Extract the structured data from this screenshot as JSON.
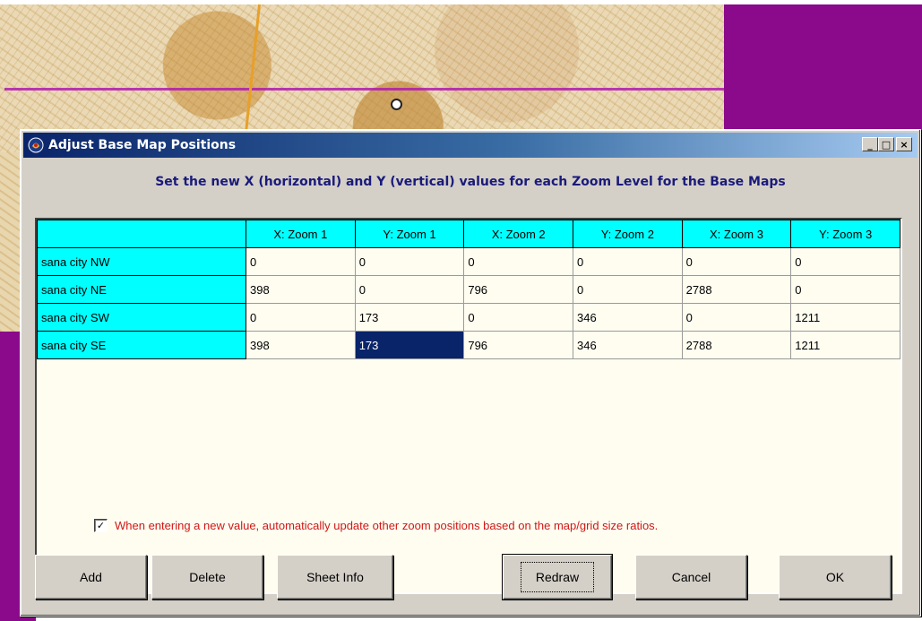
{
  "dialog": {
    "title": "Adjust Base Map Positions",
    "instruction": "Set the new X (horizontal) and Y (vertical) values for each Zoom Level for the Base Maps",
    "window_buttons": {
      "minimize": "_",
      "maximize": "□",
      "close": "×"
    }
  },
  "grid": {
    "headers": [
      "",
      "X: Zoom 1",
      "Y: Zoom 1",
      "X: Zoom 2",
      "Y: Zoom 2",
      "X: Zoom 3",
      "Y: Zoom 3"
    ],
    "rows": [
      {
        "label": "sana city NW",
        "values": [
          "0",
          "0",
          "0",
          "0",
          "0",
          "0"
        ]
      },
      {
        "label": "sana city NE",
        "values": [
          "398",
          "0",
          "796",
          "0",
          "2788",
          "0"
        ]
      },
      {
        "label": "sana city SW",
        "values": [
          "0",
          "173",
          "0",
          "346",
          "0",
          "1211"
        ]
      },
      {
        "label": "sana city SE",
        "values": [
          "398",
          "173",
          "796",
          "346",
          "2788",
          "1211"
        ]
      }
    ],
    "selected_cell": {
      "row": 3,
      "column": "Y: Zoom 1"
    }
  },
  "option": {
    "checked": true,
    "check_glyph": "✓",
    "label": "When entering a new value, automatically update other zoom positions based on the map/grid size ratios."
  },
  "buttons": {
    "add": "Add",
    "delete": "Delete",
    "sheet_info": "Sheet Info",
    "redraw": "Redraw",
    "cancel": "Cancel",
    "ok": "OK"
  },
  "colors": {
    "header_cyan": "#00ffff",
    "title_blue": "#0a246a",
    "instruction_blue": "#1a1a7a",
    "option_red": "#d01818",
    "selection": "#0a246a",
    "background_purple": "#8b0a8b"
  }
}
